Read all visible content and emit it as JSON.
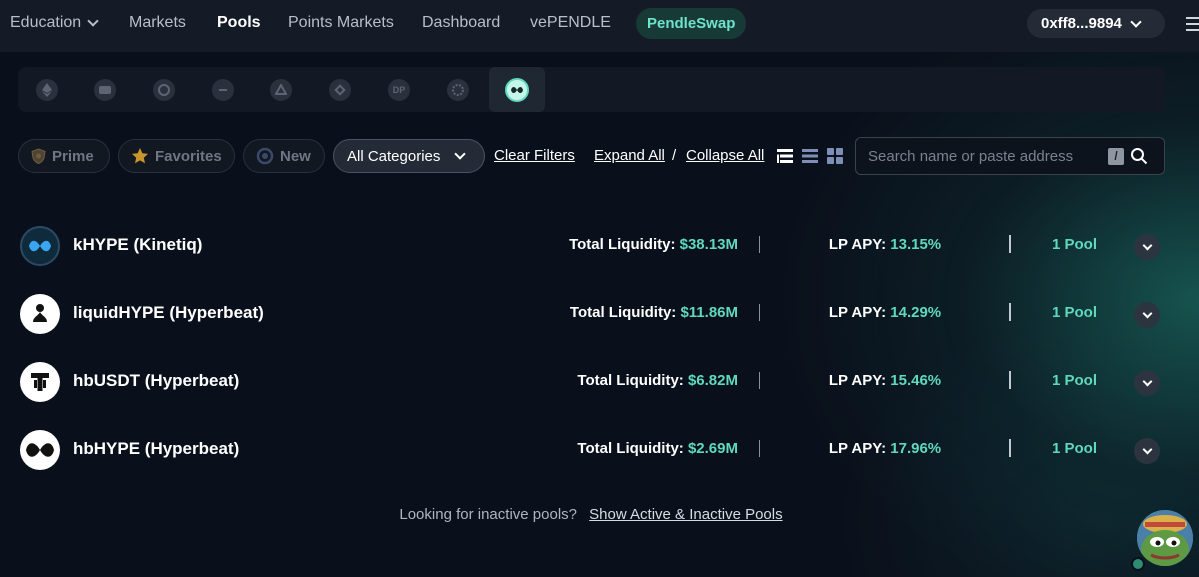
{
  "nav": {
    "items": [
      {
        "label": "Education"
      },
      {
        "label": "Markets"
      },
      {
        "label": "Pools"
      },
      {
        "label": "Points Markets"
      },
      {
        "label": "Dashboard"
      },
      {
        "label": "vePENDLE"
      }
    ],
    "active": "Pools",
    "pendleswap_label": "PendleSwap",
    "wallet_label": "0xff8...9894"
  },
  "chains": {
    "icons": [
      "ethereum-icon",
      "chain-2-icon",
      "chain-3-icon",
      "chain-4-icon",
      "arbitrum-icon",
      "bnb-icon",
      "chain-dp-icon",
      "chain-8-icon",
      "hyperevm-icon"
    ],
    "dp_label": "DP",
    "active_index": 8
  },
  "filters": {
    "prime_label": "Prime",
    "favorites_label": "Favorites",
    "new_label": "New",
    "category_selected": "All Categories",
    "clear_label": "Clear Filters",
    "expand_label": "Expand All",
    "separator": "/",
    "collapse_label": "Collapse All",
    "search_placeholder": "Search name or paste address",
    "shortcut_key": "/"
  },
  "pools": {
    "liquidity_label": "Total Liquidity:",
    "apy_label": "LP APY:",
    "rows": [
      {
        "name": "kHYPE (Kinetiq)",
        "liquidity": "$38.13M",
        "apy": "13.15%",
        "pools": "1 Pool",
        "icon": "khype-icon"
      },
      {
        "name": "liquidHYPE (Hyperbeat)",
        "liquidity": "$11.86M",
        "apy": "14.29%",
        "pools": "1 Pool",
        "icon": "liquidhype-icon"
      },
      {
        "name": "hbUSDT (Hyperbeat)",
        "liquidity": "$6.82M",
        "apy": "15.46%",
        "pools": "1 Pool",
        "icon": "hbusdt-icon"
      },
      {
        "name": "hbHYPE (Hyperbeat)",
        "liquidity": "$2.69M",
        "apy": "17.96%",
        "pools": "1 Pool",
        "icon": "hbhype-icon"
      }
    ]
  },
  "footer": {
    "question": "Looking for inactive pools?",
    "link": "Show Active & Inactive Pools"
  },
  "colors": {
    "accent": "#5fd9bd",
    "background": "#0a101b",
    "nav_bg": "#151b26"
  }
}
